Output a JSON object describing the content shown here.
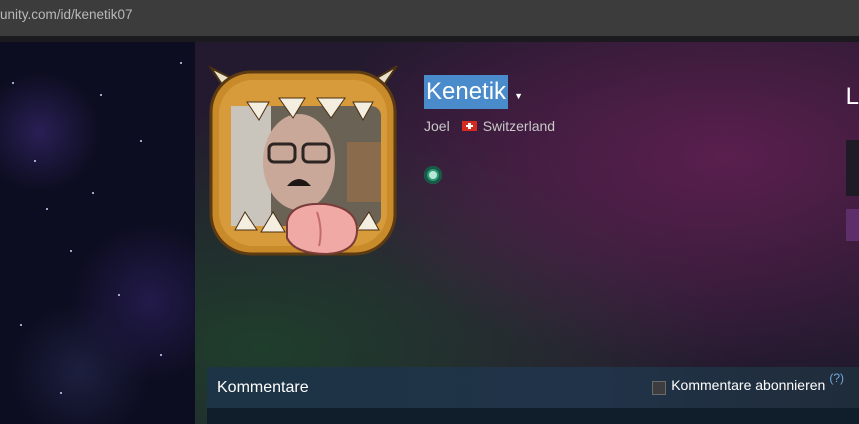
{
  "browser": {
    "url": "unity.com/id/kenetik07"
  },
  "profile": {
    "persona_name": "Kenetik",
    "real_name": "Joel",
    "country": "Switzerland",
    "right_header_partial": "L"
  },
  "comments": {
    "title": "Kommentare",
    "subscribe_label": "Kommentare abonnieren",
    "help": "(?)"
  },
  "icons": {
    "persona_menu": "chevron-down-icon",
    "country_flag": "swiss-flag-icon",
    "badge": "badge-icon"
  },
  "colors": {
    "name_highlight": "#4a8bcb",
    "help_link": "#73a7d8"
  }
}
